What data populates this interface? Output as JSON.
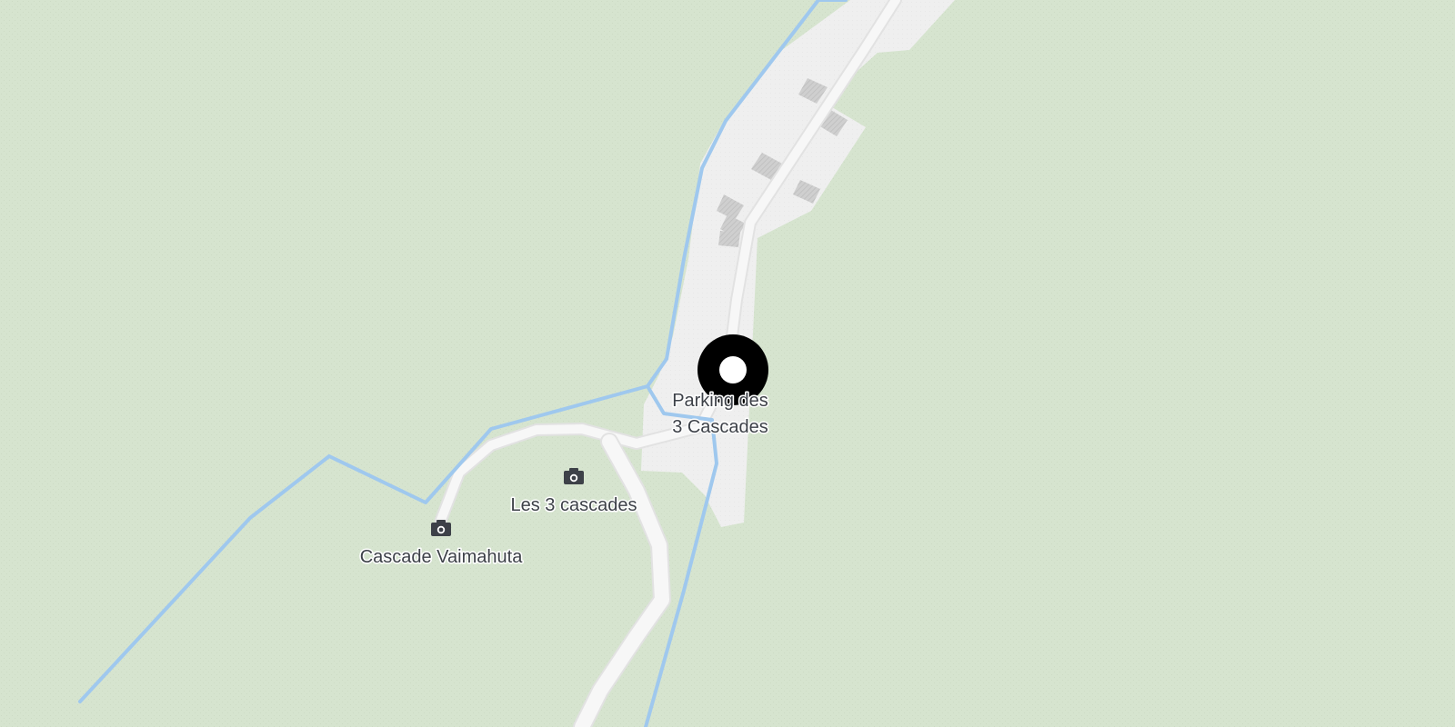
{
  "map": {
    "colors": {
      "forest": "#d6e4cf",
      "urban_area": "#eeeeee",
      "building": "#c9c9c9",
      "road": "#f7f7f7",
      "road_casing": "#e2e2e2",
      "waterway": "#9fc8ee",
      "marker": "#000000",
      "label_text": "#3d4148",
      "poi_icon": "#3d4148"
    },
    "marker": {
      "icon": "location-dot-icon"
    },
    "pois": [
      {
        "label": "Parking des",
        "label2": "3 Cascades",
        "icon": "parking-label"
      },
      {
        "label": "Les 3 cascades",
        "icon": "camera-icon"
      },
      {
        "label": "Cascade Vaimahuta",
        "icon": "camera-icon"
      }
    ]
  }
}
